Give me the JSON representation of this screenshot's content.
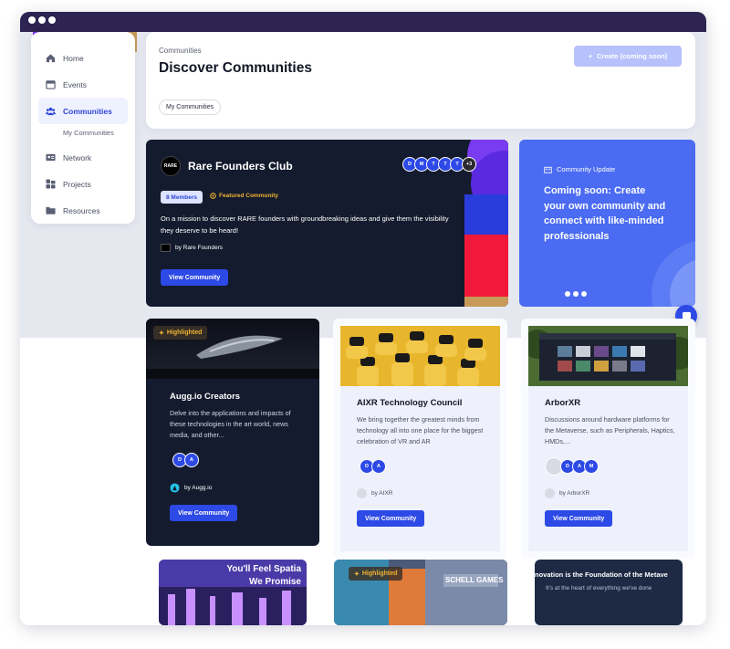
{
  "sidebar": {
    "items": [
      {
        "label": "Home",
        "icon": "home-icon"
      },
      {
        "label": "Events",
        "icon": "calendar-icon"
      },
      {
        "label": "Communities",
        "icon": "users-icon"
      },
      {
        "label": "My Communities"
      },
      {
        "label": "Network",
        "icon": "contact-card-icon"
      },
      {
        "label": "Projects",
        "icon": "blocks-icon"
      },
      {
        "label": "Resources",
        "icon": "folder-icon"
      }
    ]
  },
  "header": {
    "breadcrumb": "Communities",
    "title": "Discover Communities",
    "create_label": "Create (coming soon)",
    "chip_label": "My Communities"
  },
  "featured": {
    "logo_text": "RARE",
    "title": "Rare Founders Club",
    "avatars": [
      "D",
      "M",
      "T",
      "T",
      "T"
    ],
    "more_count": "+3",
    "members": "8 Members",
    "tag": "Featured Community",
    "description": "On a mission to discover RARE founders with groundbreaking ideas and give them the visibility they deserve to be heard!",
    "by": "by Rare Founders",
    "button": "View Community"
  },
  "update": {
    "label": "Community Update",
    "text": "Coming soon: Create your own community and connect with like-minded professionals"
  },
  "cards": [
    {
      "highlight": "Highlighted",
      "title": "Augg.io Creators",
      "description": "Delve into the applications and impacts of these technologies in the art world, news media, and other...",
      "avatars": [
        "D",
        "A"
      ],
      "by": "by Augg.io",
      "button": "View Community"
    },
    {
      "title": "AIXR Technology Council",
      "description": "We bring together the greatest minds from technology all into one place for the biggest celebration of VR and AR",
      "avatars": [
        "D",
        "A"
      ],
      "by": "by AIXR",
      "button": "View Community"
    },
    {
      "title": "ArborXR",
      "description": "Discussions around hardware platforms for the Metaverse, such as Peripherals, Haptics, HMDs,...",
      "avatars": [
        "D",
        "A",
        "M"
      ],
      "by": "by ArborXR",
      "button": "View Community"
    }
  ],
  "bottom_cards": [
    {
      "text_line1": "You'll Feel Spatia",
      "text_line2": "We Promise"
    },
    {
      "highlight": "Highlighted",
      "sign": "SCHELL GAMES"
    },
    {
      "text_line1": "novation is the Foundation of the Metave",
      "text_line2": "It's at the heart of everything we've done"
    }
  ],
  "colors": {
    "accent": "#2d49e6",
    "titlebar": "#2e2452",
    "featured_bg": "#141b2e",
    "update_bg": "#4a6bf2",
    "highlight": "#f0b232"
  }
}
